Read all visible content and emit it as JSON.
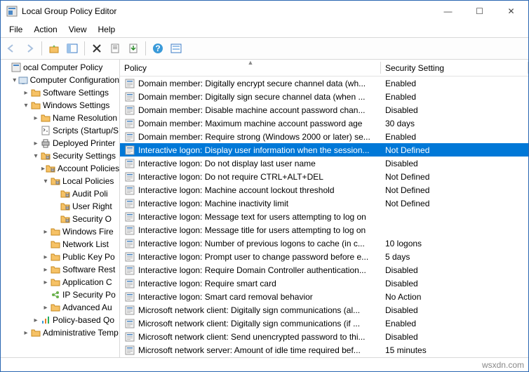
{
  "window": {
    "title": "Local Group Policy Editor",
    "controls": {
      "minimize": "—",
      "maximize": "☐",
      "close": "✕"
    }
  },
  "menu": [
    "File",
    "Action",
    "View",
    "Help"
  ],
  "tree": [
    {
      "indent": 0,
      "twisty": "",
      "icon": "policy",
      "label": "ocal Computer Policy"
    },
    {
      "indent": 1,
      "twisty": "▾",
      "icon": "config",
      "label": "Computer Configuration"
    },
    {
      "indent": 2,
      "twisty": "▸",
      "icon": "folder",
      "label": "Software Settings"
    },
    {
      "indent": 2,
      "twisty": "▾",
      "icon": "folder",
      "label": "Windows Settings"
    },
    {
      "indent": 3,
      "twisty": "▸",
      "icon": "folder",
      "label": "Name Resolution"
    },
    {
      "indent": 3,
      "twisty": "",
      "icon": "script",
      "label": "Scripts (Startup/S"
    },
    {
      "indent": 3,
      "twisty": "▸",
      "icon": "printer",
      "label": "Deployed Printer"
    },
    {
      "indent": 3,
      "twisty": "▾",
      "icon": "secfold",
      "label": "Security Settings"
    },
    {
      "indent": 4,
      "twisty": "▸",
      "icon": "secfold",
      "label": "Account Policies"
    },
    {
      "indent": 4,
      "twisty": "▾",
      "icon": "secfold",
      "label": "Local Policies"
    },
    {
      "indent": 5,
      "twisty": "",
      "icon": "secfold",
      "label": "Audit Poli"
    },
    {
      "indent": 5,
      "twisty": "",
      "icon": "secfold",
      "label": "User Right"
    },
    {
      "indent": 5,
      "twisty": "",
      "icon": "secfold",
      "label": "Security O"
    },
    {
      "indent": 4,
      "twisty": "▸",
      "icon": "folder",
      "label": "Windows Fire"
    },
    {
      "indent": 4,
      "twisty": "",
      "icon": "folder",
      "label": "Network List "
    },
    {
      "indent": 4,
      "twisty": "▸",
      "icon": "folder",
      "label": "Public Key Po"
    },
    {
      "indent": 4,
      "twisty": "▸",
      "icon": "folder",
      "label": "Software Rest"
    },
    {
      "indent": 4,
      "twisty": "▸",
      "icon": "folder",
      "label": "Application C"
    },
    {
      "indent": 4,
      "twisty": "",
      "icon": "ipsec",
      "label": "IP Security Po"
    },
    {
      "indent": 4,
      "twisty": "▸",
      "icon": "folder",
      "label": "Advanced Au"
    },
    {
      "indent": 3,
      "twisty": "▸",
      "icon": "qos",
      "label": "Policy-based Qo"
    },
    {
      "indent": 2,
      "twisty": "▸",
      "icon": "folder",
      "label": "Administrative Temp"
    }
  ],
  "columns": {
    "policy": "Policy",
    "setting": "Security Setting"
  },
  "policies": [
    {
      "name": "Domain member: Digitally encrypt secure channel data (wh...",
      "setting": "Enabled"
    },
    {
      "name": "Domain member: Digitally sign secure channel data (when ...",
      "setting": "Enabled"
    },
    {
      "name": "Domain member: Disable machine account password chan...",
      "setting": "Disabled"
    },
    {
      "name": "Domain member: Maximum machine account password age",
      "setting": "30 days"
    },
    {
      "name": "Domain member: Require strong (Windows 2000 or later) se...",
      "setting": "Enabled"
    },
    {
      "name": "Interactive logon: Display user information when the session...",
      "setting": "Not Defined",
      "selected": true
    },
    {
      "name": "Interactive logon: Do not display last user name",
      "setting": "Disabled"
    },
    {
      "name": "Interactive logon: Do not require CTRL+ALT+DEL",
      "setting": "Not Defined"
    },
    {
      "name": "Interactive logon: Machine account lockout threshold",
      "setting": "Not Defined"
    },
    {
      "name": "Interactive logon: Machine inactivity limit",
      "setting": "Not Defined"
    },
    {
      "name": "Interactive logon: Message text for users attempting to log on",
      "setting": ""
    },
    {
      "name": "Interactive logon: Message title for users attempting to log on",
      "setting": ""
    },
    {
      "name": "Interactive logon: Number of previous logons to cache (in c...",
      "setting": "10 logons"
    },
    {
      "name": "Interactive logon: Prompt user to change password before e...",
      "setting": "5 days"
    },
    {
      "name": "Interactive logon: Require Domain Controller authentication...",
      "setting": "Disabled"
    },
    {
      "name": "Interactive logon: Require smart card",
      "setting": "Disabled"
    },
    {
      "name": "Interactive logon: Smart card removal behavior",
      "setting": "No Action"
    },
    {
      "name": "Microsoft network client: Digitally sign communications (al...",
      "setting": "Disabled"
    },
    {
      "name": "Microsoft network client: Digitally sign communications (if ...",
      "setting": "Enabled"
    },
    {
      "name": "Microsoft network client: Send unencrypted password to thi...",
      "setting": "Disabled"
    },
    {
      "name": "Microsoft network server: Amount of idle time required bef...",
      "setting": "15 minutes"
    }
  ],
  "footer": "wsxdn.com"
}
